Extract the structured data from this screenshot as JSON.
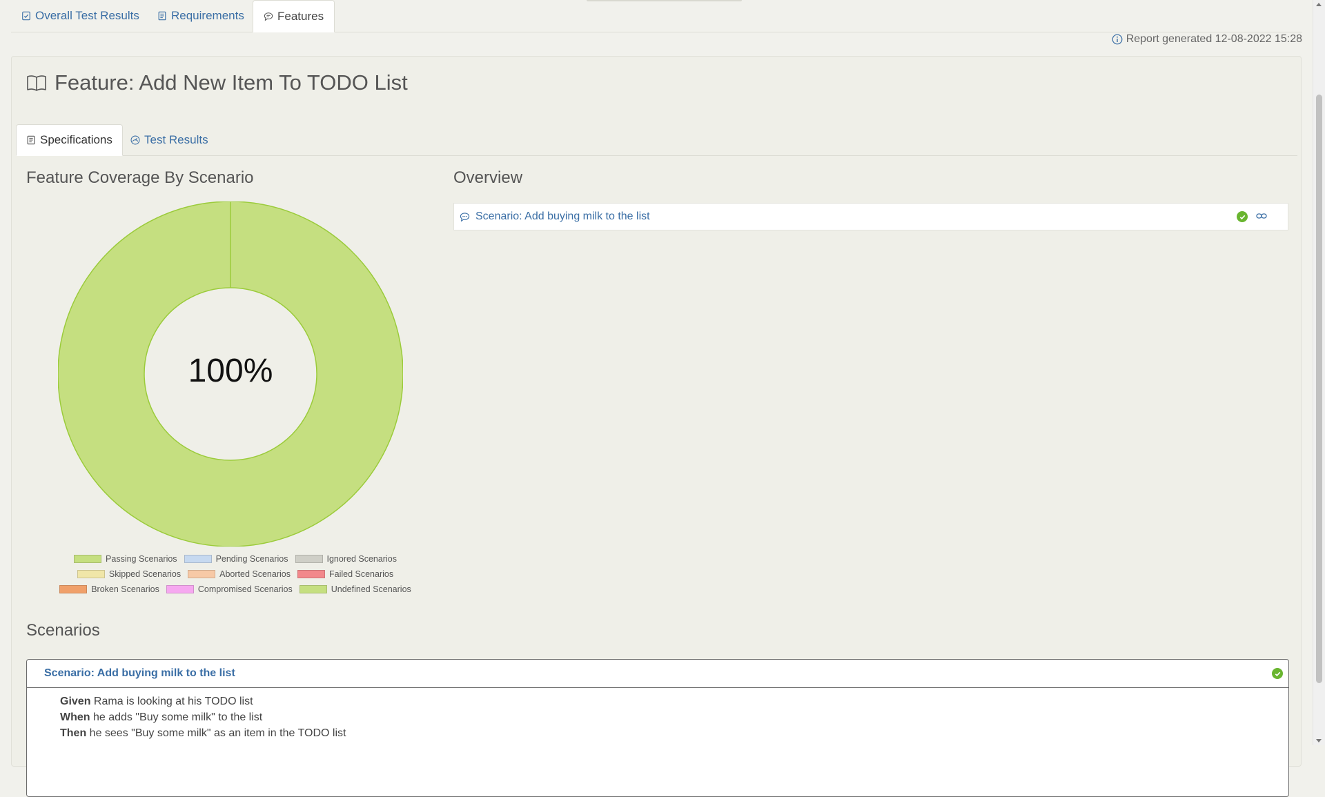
{
  "top_tabs": [
    {
      "label": "Overall Test Results",
      "icon": "checklist-icon"
    },
    {
      "label": "Requirements",
      "icon": "document-icon"
    },
    {
      "label": "Features",
      "icon": "comment-icon"
    }
  ],
  "report_generated": "Report generated 12-08-2022 15:28",
  "feature_title": "Feature: Add New Item To TODO List",
  "sub_tabs": [
    {
      "label": "Specifications",
      "icon": "document-icon"
    },
    {
      "label": "Test Results",
      "icon": "dashboard-icon"
    }
  ],
  "coverage_heading": "Feature Coverage By Scenario",
  "overview_heading": "Overview",
  "scenarios_heading": "Scenarios",
  "chart_data": {
    "type": "pie",
    "center_label": "100%",
    "categories": [
      "Passing Scenarios",
      "Pending Scenarios",
      "Ignored Scenarios",
      "Skipped Scenarios",
      "Aborted Scenarios",
      "Failed Scenarios",
      "Broken Scenarios",
      "Compromised Scenarios",
      "Undefined Scenarios"
    ],
    "values": [
      1,
      0,
      0,
      0,
      0,
      0,
      0,
      0,
      0
    ],
    "colors": [
      "#c5df80",
      "#c6d9f0",
      "#cfcfc7",
      "#f0e6a8",
      "#f7c9a6",
      "#f2888b",
      "#f0a06a",
      "#f6a8f0",
      "#c5df80"
    ],
    "legend": "bottom"
  },
  "overview": {
    "scenario_label": "Scenario: Add buying milk to the list",
    "status": "passed"
  },
  "scenario": {
    "title": "Scenario: Add buying milk to the list",
    "status": "passed",
    "steps": [
      {
        "keyword": "Given",
        "text": " Rama is looking at his TODO list"
      },
      {
        "keyword": "When",
        "text": " he adds \"Buy some milk\" to the list"
      },
      {
        "keyword": "Then",
        "text": " he sees \"Buy some milk\" as an item in the TODO list"
      }
    ]
  },
  "colors": {
    "link": "#3a6ea5",
    "passing": "#c5df80",
    "success_icon": "#69b52f"
  }
}
